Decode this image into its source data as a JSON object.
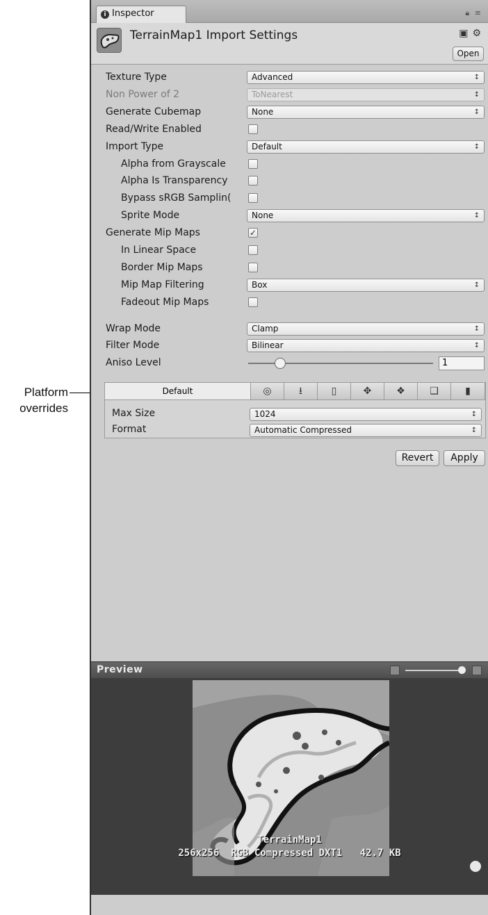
{
  "callout": {
    "line1": "Platform",
    "line2": "overrides"
  },
  "tab": {
    "title": "Inspector"
  },
  "header": {
    "title": "TerrainMap1 Import Settings",
    "open_label": "Open"
  },
  "properties": [
    {
      "label": "Texture Type",
      "type": "dropdown",
      "value": "Advanced",
      "indent": false,
      "disabled": false
    },
    {
      "label": "Non Power of 2",
      "type": "dropdown",
      "value": "ToNearest",
      "indent": false,
      "disabled": true
    },
    {
      "label": "Generate Cubemap",
      "type": "dropdown",
      "value": "None",
      "indent": false,
      "disabled": false
    },
    {
      "label": "Read/Write Enabled",
      "type": "checkbox",
      "checked": false,
      "indent": false,
      "disabled": false
    },
    {
      "label": "Import Type",
      "type": "dropdown",
      "value": "Default",
      "indent": false,
      "disabled": false
    },
    {
      "label": "Alpha from Grayscale",
      "type": "checkbox",
      "checked": false,
      "indent": true,
      "disabled": false
    },
    {
      "label": "Alpha Is Transparency",
      "type": "checkbox",
      "checked": false,
      "indent": true,
      "disabled": false
    },
    {
      "label": "Bypass sRGB Samplin(",
      "type": "checkbox",
      "checked": false,
      "indent": true,
      "disabled": false
    },
    {
      "label": "Sprite Mode",
      "type": "dropdown",
      "value": "None",
      "indent": true,
      "disabled": false
    },
    {
      "label": "Generate Mip Maps",
      "type": "checkbox",
      "checked": true,
      "indent": false,
      "disabled": false
    },
    {
      "label": "In Linear Space",
      "type": "checkbox",
      "checked": false,
      "indent": true,
      "disabled": false
    },
    {
      "label": "Border Mip Maps",
      "type": "checkbox",
      "checked": false,
      "indent": true,
      "disabled": false
    },
    {
      "label": "Mip Map Filtering",
      "type": "dropdown",
      "value": "Box",
      "indent": true,
      "disabled": false
    },
    {
      "label": "Fadeout Mip Maps",
      "type": "checkbox",
      "checked": false,
      "indent": true,
      "disabled": false
    },
    {
      "label": "Wrap Mode",
      "type": "dropdown",
      "value": "Clamp",
      "indent": false,
      "disabled": false
    },
    {
      "label": "Filter Mode",
      "type": "dropdown",
      "value": "Bilinear",
      "indent": false,
      "disabled": false
    },
    {
      "label": "Aniso Level",
      "type": "slider",
      "value": "1",
      "indent": false,
      "disabled": false
    }
  ],
  "platform": {
    "default_tab": "Default",
    "icons": [
      "globe-icon",
      "download-icon",
      "phone-icon",
      "android-icon",
      "blackberry-icon",
      "windows-icon",
      "device-icon"
    ],
    "max_size_label": "Max Size",
    "max_size_value": "1024",
    "format_label": "Format",
    "format_value": "Automatic Compressed"
  },
  "buttons": {
    "revert": "Revert",
    "apply": "Apply"
  },
  "preview": {
    "title": "Preview",
    "asset_name": "TerrainMap1",
    "info": "256x256  RGB Compressed DXT1   42.7 KB"
  }
}
